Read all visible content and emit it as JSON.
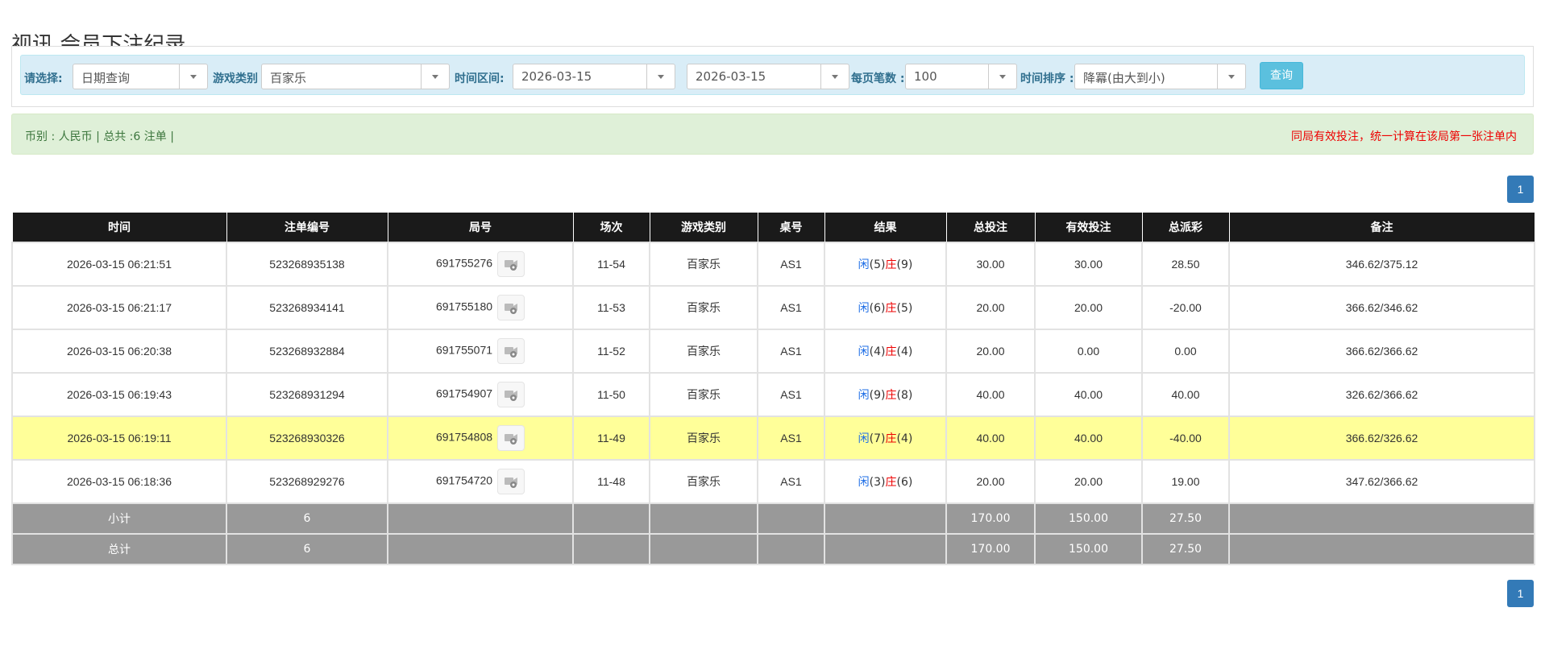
{
  "page": {
    "title": "视讯 会员下注纪录"
  },
  "filters": {
    "select_label": "请选择:",
    "query_type": "日期查询",
    "game_label": "游戏类别",
    "game_value": "百家乐",
    "time_label": "时间区间:",
    "date_from": "2026-03-15",
    "tilde": "~",
    "date_to": "2026-03-15",
    "per_page_label": "每页笔数 :",
    "per_page_value": "100",
    "sort_label": "时间排序 :",
    "sort_value": "降冪(由大到小)",
    "query_button": "查询"
  },
  "info": {
    "summary": "币别 : 人民币 | 总共 :6 注单 |",
    "notice": "同局有效投注，统一计算在该局第一张注单内"
  },
  "pagination": {
    "page": "1"
  },
  "table": {
    "headers": [
      "时间",
      "注单编号",
      "局号",
      "场次",
      "游戏类别",
      "桌号",
      "结果",
      "总投注",
      "有效投注",
      "总派彩",
      "备注"
    ],
    "rows": [
      {
        "time": "2026-03-15 06:21:51",
        "bet_no": "523268935138",
        "round": "691755276",
        "shoe": "11-54",
        "game": "百家乐",
        "table": "AS1",
        "player_label": "闲",
        "player_pts": "(5)",
        "banker_label": "庄",
        "banker_pts": "(9)",
        "total_bet": "30.00",
        "valid_bet": "30.00",
        "payout": "28.50",
        "payout_neg": false,
        "note": "346.62/375.12"
      },
      {
        "time": "2026-03-15 06:21:17",
        "bet_no": "523268934141",
        "round": "691755180",
        "shoe": "11-53",
        "game": "百家乐",
        "table": "AS1",
        "player_label": "闲",
        "player_pts": "(6)",
        "banker_label": "庄",
        "banker_pts": "(5)",
        "total_bet": "20.00",
        "valid_bet": "20.00",
        "payout": "-20.00",
        "payout_neg": true,
        "note": "366.62/346.62"
      },
      {
        "time": "2026-03-15 06:20:38",
        "bet_no": "523268932884",
        "round": "691755071",
        "shoe": "11-52",
        "game": "百家乐",
        "table": "AS1",
        "player_label": "闲",
        "player_pts": "(4)",
        "banker_label": "庄",
        "banker_pts": "(4)",
        "total_bet": "20.00",
        "valid_bet": "0.00",
        "payout": "0.00",
        "payout_neg": false,
        "note": "366.62/366.62"
      },
      {
        "time": "2026-03-15 06:19:43",
        "bet_no": "523268931294",
        "round": "691754907",
        "shoe": "11-50",
        "game": "百家乐",
        "table": "AS1",
        "player_label": "闲",
        "player_pts": "(9)",
        "banker_label": "庄",
        "banker_pts": "(8)",
        "total_bet": "40.00",
        "valid_bet": "40.00",
        "payout": "40.00",
        "payout_neg": false,
        "note": "326.62/366.62"
      },
      {
        "time": "2026-03-15 06:19:11",
        "bet_no": "523268930326",
        "round": "691754808",
        "shoe": "11-49",
        "game": "百家乐",
        "table": "AS1",
        "player_label": "闲",
        "player_pts": "(7)",
        "banker_label": "庄",
        "banker_pts": "(4)",
        "total_bet": "40.00",
        "valid_bet": "40.00",
        "payout": "-40.00",
        "payout_neg": true,
        "note": "366.62/326.62"
      },
      {
        "time": "2026-03-15 06:18:36",
        "bet_no": "523268929276",
        "round": "691754720",
        "shoe": "11-48",
        "game": "百家乐",
        "table": "AS1",
        "player_label": "闲",
        "player_pts": "(3)",
        "banker_label": "庄",
        "banker_pts": "(6)",
        "total_bet": "20.00",
        "valid_bet": "20.00",
        "payout": "19.00",
        "payout_neg": false,
        "note": "347.62/366.62"
      }
    ],
    "subtotal": {
      "label": "小计",
      "count": "6",
      "total_bet": "170.00",
      "valid_bet": "150.00",
      "payout": "27.50"
    },
    "grandtotal": {
      "label": "总计",
      "count": "6",
      "total_bet": "170.00",
      "valid_bet": "150.00",
      "payout": "27.50"
    }
  },
  "colors": {
    "header_bg": "#1a1a1a",
    "highlight_row": "#ffff99",
    "summary_bg": "#999999",
    "player_blue": "#1e6ee6",
    "banker_red": "#ee0000",
    "pager_blue": "#337ab7"
  },
  "icons": {
    "replay": "video-replay-icon"
  }
}
